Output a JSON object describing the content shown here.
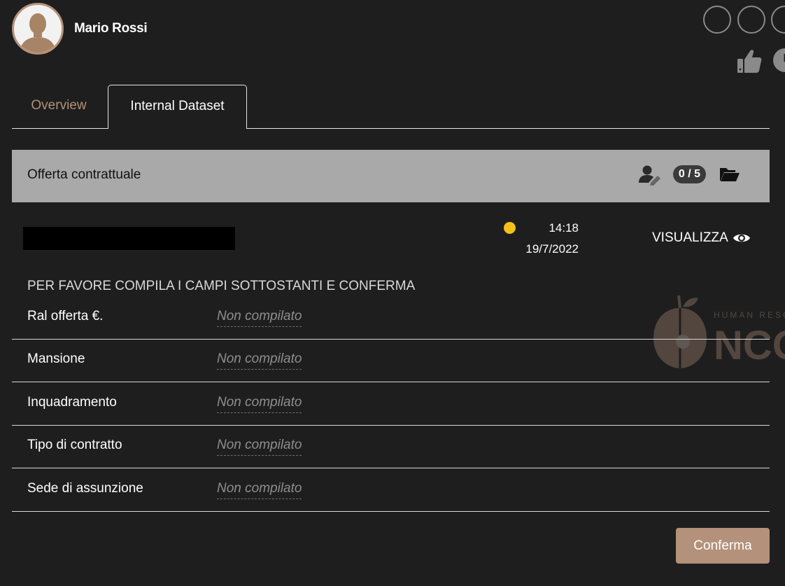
{
  "user": {
    "name": "Mario Rossi"
  },
  "tabs": [
    {
      "label": "Overview",
      "active": false
    },
    {
      "label": "Internal Dataset",
      "active": true
    }
  ],
  "section": {
    "title": "Offerta contrattuale",
    "counter": "0 / 5"
  },
  "entry": {
    "status_color": "#f3c118",
    "time": "14:18",
    "date": "19/7/2022",
    "view_label": "VISUALIZZA"
  },
  "form": {
    "instructions": "PER FAVORE COMPILA I CAMPI SOTTOSTANTI E CONFERMA",
    "fields": [
      {
        "label": "Ral offerta €.",
        "value": "Non compilato"
      },
      {
        "label": "Mansione",
        "value": "Non compilato"
      },
      {
        "label": "Inquadramento",
        "value": "Non compilato"
      },
      {
        "label": "Tipo di contratto",
        "value": "Non compilato"
      },
      {
        "label": "Sede di assunzione",
        "value": "Non compilato"
      }
    ],
    "confirm_label": "Conferma"
  },
  "watermark": {
    "tagline": "HUMAN RESO",
    "brand": "NCO"
  },
  "colors": {
    "accent": "#b4917a",
    "background": "#1e1e1e",
    "header_bar": "#a9a9a9"
  },
  "icons": [
    "avatar-icon",
    "thumbs-up-icon",
    "clock-icon",
    "user-edit-icon",
    "folder-open-icon",
    "eye-icon"
  ]
}
